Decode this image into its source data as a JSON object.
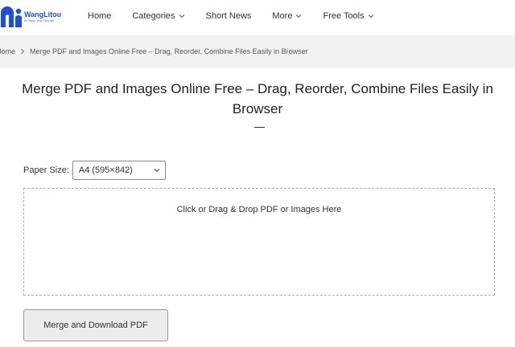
{
  "header": {
    "brand_name": "WangLitou",
    "brand_tagline": "AI Tools You Choose",
    "nav": [
      {
        "label": "Home",
        "has_dropdown": false
      },
      {
        "label": "Categories",
        "has_dropdown": true
      },
      {
        "label": "Short News",
        "has_dropdown": false
      },
      {
        "label": "More",
        "has_dropdown": true
      },
      {
        "label": "Free Tools",
        "has_dropdown": true
      }
    ]
  },
  "breadcrumb": {
    "home": "Home",
    "current": "Merge PDF and Images Online Free – Drag, Reorder, Combine Files Easily in Browser"
  },
  "main": {
    "title": "Merge PDF and Images Online Free – Drag, Reorder, Combine Files Easily in Browser",
    "paper_size_label": "Paper Size:",
    "paper_size_value": "A4 (595×842)",
    "dropzone_text": "Click or Drag & Drop PDF or Images Here",
    "merge_button": "Merge and Download PDF"
  },
  "colors": {
    "brand": "#1f4fd6",
    "breadcrumb_band": "#f2f2f2",
    "button_bg": "#ececec"
  }
}
